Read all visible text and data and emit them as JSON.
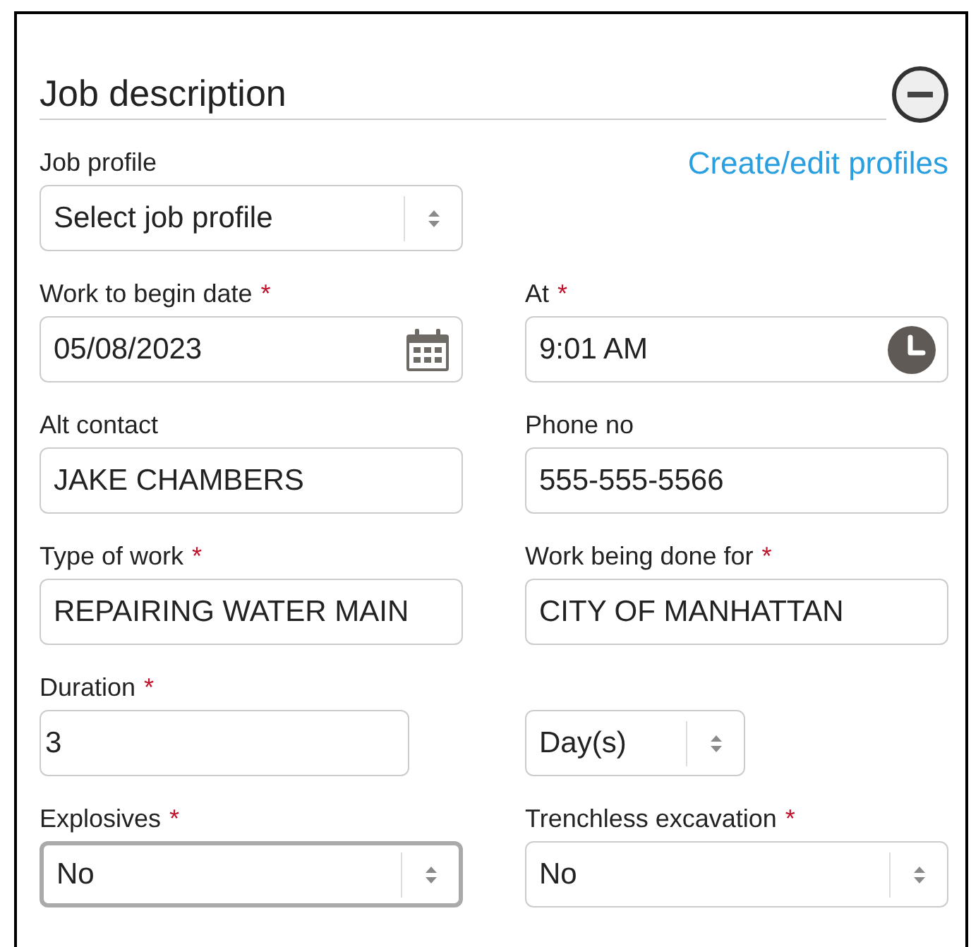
{
  "section": {
    "title": "Job description",
    "link": "Create/edit profiles"
  },
  "rows": [
    {
      "fields": [
        {
          "kind": "select",
          "label": "Job profile",
          "value": "Select job profile",
          "focused": false
        }
      ]
    },
    {
      "fields": [
        {
          "kind": "date",
          "label": "Work to begin date",
          "mark": "*",
          "value": "05/08/2023",
          "focused": false
        },
        {
          "kind": "time",
          "label": "At",
          "mark": "*",
          "value": "9:01 AM",
          "focused": false
        }
      ]
    },
    {
      "fields": [
        {
          "kind": "text",
          "label": "Alt contact",
          "value": "JAKE CHAMBERS",
          "focused": false
        },
        {
          "kind": "text",
          "label": "Phone no",
          "value": "555-555-5566",
          "focused": false
        }
      ]
    },
    {
      "fields": [
        {
          "kind": "text",
          "label": "Type of work",
          "mark": "*",
          "value": "REPAIRING WATER MAIN",
          "focused": false
        },
        {
          "kind": "text",
          "label": "Work being done for",
          "mark": "*",
          "value": "CITY OF MANHATTAN",
          "focused": false
        }
      ]
    },
    {
      "fields": [
        {
          "kind": "number",
          "label": "Duration",
          "mark": "*",
          "value": "3",
          "focused": false
        },
        {
          "kind": "unit_select",
          "value": "Day(s)",
          "focused": false
        }
      ]
    },
    {
      "fields": [
        {
          "kind": "select",
          "label": "Explosives",
          "mark": "*",
          "value": "No",
          "focused": true
        },
        {
          "kind": "select",
          "label": "Trenchless excavation",
          "mark": "*",
          "value": "No",
          "focused": false
        }
      ]
    }
  ]
}
